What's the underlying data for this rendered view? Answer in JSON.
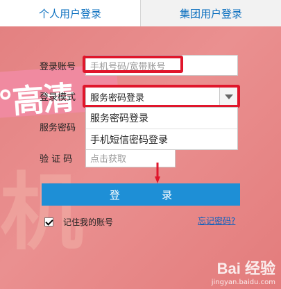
{
  "tabs": {
    "personal": "个人用户登录",
    "group": "集团用户登录"
  },
  "form": {
    "account_label": "登录账号",
    "account_placeholder": "手机号码/宽带账号",
    "mode_label": "登录模式",
    "mode_value": "服务密码登录",
    "password_label": "服务密码",
    "captcha_label": "验 证 码",
    "captcha_hint": "点击获取",
    "mode_options": [
      "服务密码登录",
      "手机短信密码登录"
    ]
  },
  "login_button": "登 录",
  "remember_label": "记住我的账号",
  "forgot_link": "忘记密码?",
  "banner_text": "°高清",
  "big_glyph": "机",
  "watermark": {
    "main": "Bai 经验",
    "sub": "jingyan.baidu.com"
  },
  "colors": {
    "accent": "#1e8fd6",
    "highlight": "#e0162b",
    "background": "#e58a8a",
    "tab_text": "#0a6fbf"
  },
  "icons": {
    "select_caret": "chevron-down-icon",
    "pointer_arrow": "arrow-down-icon",
    "checkbox": "checkbox-checked-icon"
  }
}
